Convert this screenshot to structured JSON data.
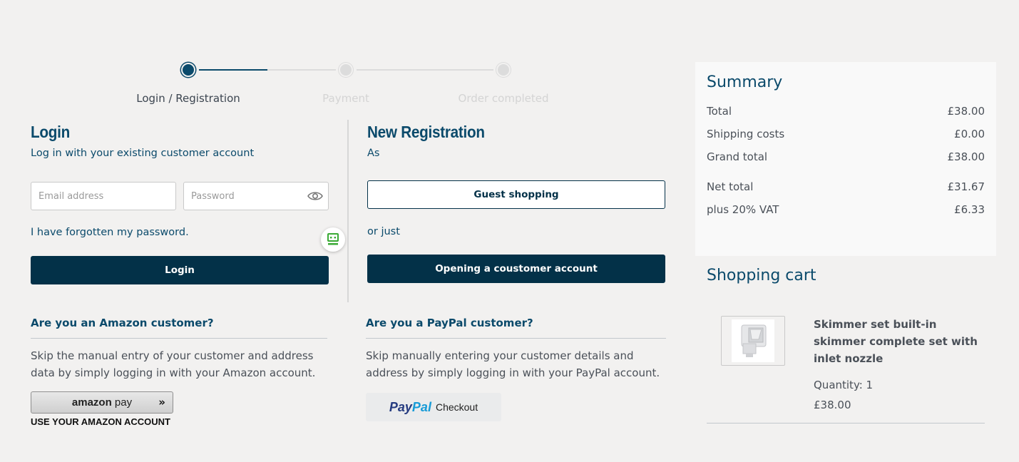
{
  "stepper": {
    "steps": [
      {
        "label": "Login / Registration",
        "state": "active"
      },
      {
        "label": "Payment",
        "state": "inactive"
      },
      {
        "label": "Order completed",
        "state": "inactive"
      }
    ],
    "progress_within_first_segment": 0.5
  },
  "login": {
    "title": "Login",
    "subtitle": "Log in with your existing customer account",
    "email_placeholder": "Email address",
    "email_value": "",
    "password_placeholder": "Password",
    "password_value": "",
    "show_password_icon": "eye-icon",
    "password_manager_icon": "password-manager-icon",
    "forgot_link": "I have forgotten my password.",
    "submit_label": "Login"
  },
  "registration": {
    "title": "New Registration",
    "subtitle": "As",
    "guest_label": "Guest shopping",
    "or_text": "or just",
    "open_account_label": "Opening a coustomer account"
  },
  "amazon": {
    "title": "Are you an Amazon customer?",
    "text": "Skip the manual entry of your customer and address data by simply logging in with your Amazon account.",
    "button_logo_bold": "amazon",
    "button_logo_light": " pay",
    "button_arrow": "»",
    "caption": "USE YOUR AMAZON ACCOUNT"
  },
  "paypal": {
    "title": "Are you a PayPal customer?",
    "text": "Skip manually entering your customer details and address by simply logging in with your PayPal account.",
    "logo_pay": "Pay",
    "logo_pal": "Pal",
    "button_label": "Checkout"
  },
  "summary": {
    "title": "Summary",
    "rows": [
      {
        "label": "Total",
        "value": "£38.00"
      },
      {
        "label": "Shipping costs",
        "value": "£0.00"
      },
      {
        "label": "Grand total",
        "value": "£38.00"
      },
      {
        "label": "Net total",
        "value": "£31.67"
      },
      {
        "label": "plus 20% VAT",
        "value": "£6.33"
      }
    ]
  },
  "cart": {
    "title": "Shopping cart",
    "items": [
      {
        "name": "Skimmer set built-in skimmer complete set with inlet nozzle",
        "quantity": "Quantity: 1",
        "price": "£38.00",
        "image_icon": "skimmer-product-image"
      }
    ]
  },
  "colors": {
    "brand_primary": "#0b4a6b",
    "button_dark": "#033148",
    "background": "#f2f1f0",
    "inactive_step": "#dcdcdc"
  }
}
